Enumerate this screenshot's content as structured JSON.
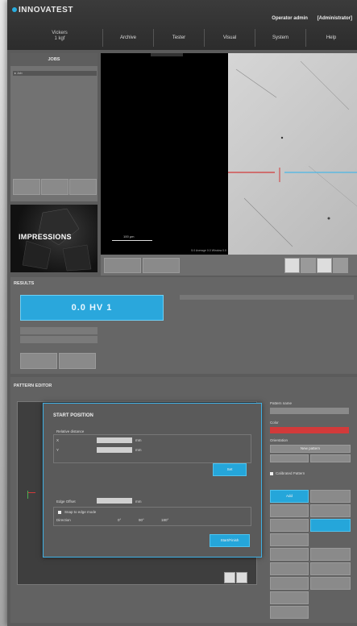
{
  "app": {
    "logo": "INNOVATEST",
    "user": "Operator admin",
    "role": "[Administrator]",
    "method": "Vickers",
    "method_sub": "1 kgf"
  },
  "nav": [
    "Archive",
    "Tester",
    "Visual",
    "System",
    "Help"
  ],
  "jobs": {
    "title": "JOBS",
    "item": "Job"
  },
  "impressions": "IMPRESSIONS",
  "image": {
    "scale": "100 µm",
    "info": "5.0   Average 0.0   Window 0.0"
  },
  "results": {
    "title": "RESULTS",
    "value": "0.0 HV 1"
  },
  "pattern": {
    "title": "PATTERN EDITOR",
    "dialog_title": "START POSITION",
    "relative": "Relative distance",
    "x_label": "X",
    "y_label": "Y",
    "unit": "mm",
    "set_btn": "Set",
    "edge_label": "Edge Offset",
    "snap": "Snap to edge mode",
    "direction": "Direction",
    "angles": [
      "0°",
      "90°",
      "180°"
    ],
    "ok_btn": "Start/Finish"
  },
  "right": {
    "pattern_name": "Pattern name",
    "color": "Color",
    "orientation": "Orientation",
    "new_pattern": "New pattern",
    "checkbox": "Calibrated Pattern",
    "tab": "Add"
  },
  "colors": {
    "accent": "#25a6da",
    "red": "#d23a3a"
  }
}
